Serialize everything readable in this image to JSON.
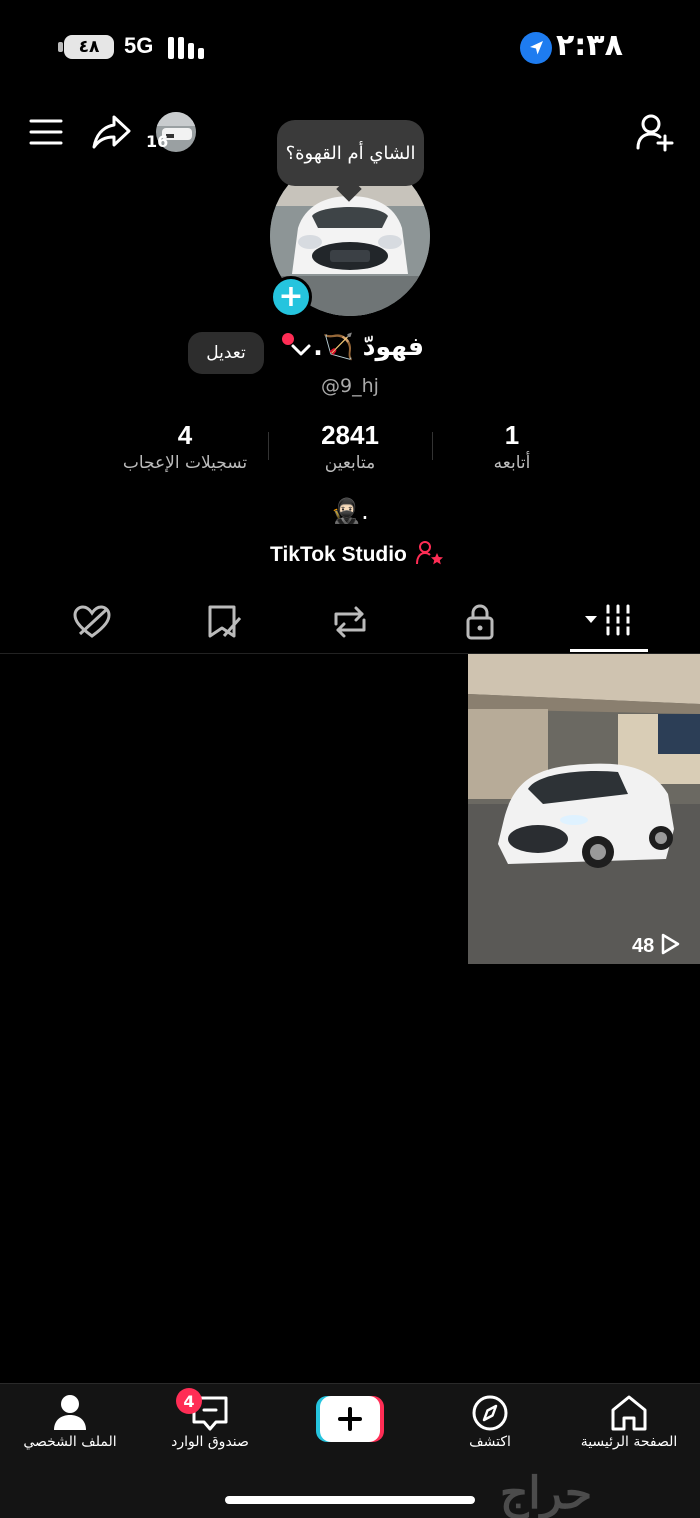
{
  "status_bar": {
    "battery": "٤٨",
    "network": "5G",
    "time": "٢:٣٨"
  },
  "header": {
    "story_count": "16",
    "icons": [
      "menu-icon",
      "share-icon",
      "add-friend-icon"
    ]
  },
  "profile": {
    "note": "الشاي أم القهوة؟",
    "name": "فهودّ 🏹.",
    "handle": "@9_hj",
    "edit_label": "تعديل",
    "bio": "🥷🏻.",
    "studio_label": "TikTok Studio"
  },
  "stats": [
    {
      "value": "1",
      "label": "أتابعه"
    },
    {
      "value": "2841",
      "label": "متابعين"
    },
    {
      "value": "4",
      "label": "تسجيلات الإعجاب"
    }
  ],
  "tabs": [
    "videos-tab",
    "private-tab",
    "reposts-tab",
    "favorites-tab",
    "liked-tab"
  ],
  "videos": [
    {
      "views": "48"
    }
  ],
  "bottom_nav": {
    "home": "الصفحة الرئيسية",
    "explore": "اكتشف",
    "create": "+",
    "inbox": "صندوق الوارد",
    "inbox_badge": "4",
    "profile": "الملف الشخصي"
  },
  "watermark": "حراج",
  "colors": {
    "accent_red": "#ff2d55",
    "accent_cyan": "#25c4de",
    "location_blue": "#1e7cf0"
  }
}
